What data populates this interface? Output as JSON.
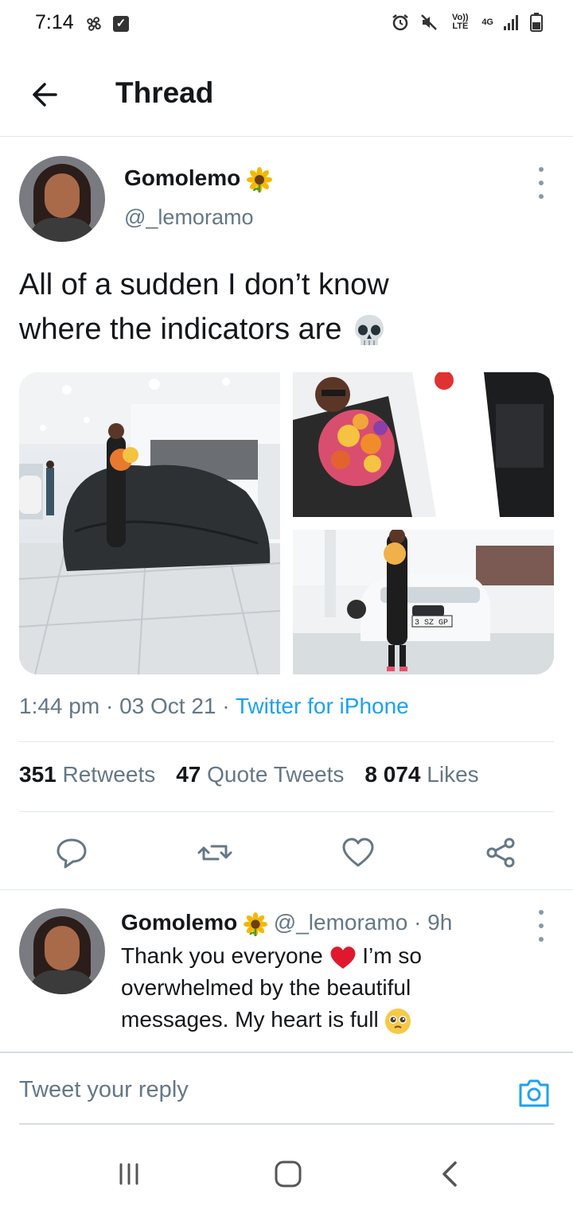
{
  "status_bar": {
    "time": "7:14",
    "network_label": "Vo)) LTE",
    "network_type": "4G"
  },
  "header": {
    "title": "Thread"
  },
  "tweet": {
    "author_name": "Gomolemo",
    "author_handle": "@_lemoramo",
    "text_line1": "All of a sudden I don’t know",
    "text_line2": "where the indicators are",
    "time": "1:44 pm",
    "date": "03 Oct 21",
    "source": "Twitter for iPhone",
    "retweets_count": "351",
    "retweets_label": "Retweets",
    "quotes_count": "47",
    "quotes_label": "Quote Tweets",
    "likes_count": "8 074",
    "likes_label": "Likes",
    "plate_text": "3 SZ GP"
  },
  "reply": {
    "author_name": "Gomolemo",
    "author_handle": "@_lemoramo",
    "age": "9h",
    "text_line1": "Thank you everyone",
    "text_line1b": "I’m so",
    "text_line2": "overwhelmed by the beautiful",
    "text_line3": "messages. My heart is full"
  },
  "composer": {
    "placeholder": "Tweet your reply"
  },
  "colors": {
    "link": "#1da1f2",
    "muted": "#657786",
    "text": "#14171a",
    "divider": "#e1e8ed"
  }
}
